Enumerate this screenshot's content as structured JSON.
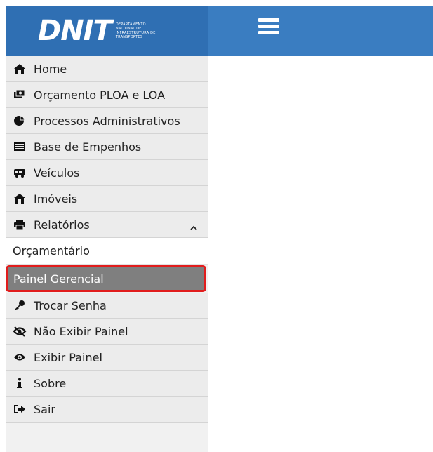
{
  "header": {
    "logo_text": "DNIT",
    "logo_subtitle": "Departamento Nacional de Infraestrutura de Transportes",
    "menu_icon": "hamburger-icon"
  },
  "sidebar": {
    "items": [
      {
        "label": "Home",
        "icon": "home-icon"
      },
      {
        "label": "Orçamento PLOA e LOA",
        "icon": "money-icon"
      },
      {
        "label": "Processos Administrativos",
        "icon": "pie-chart-icon"
      },
      {
        "label": "Base de Empenhos",
        "icon": "table-icon"
      },
      {
        "label": "Veículos",
        "icon": "bus-icon"
      },
      {
        "label": "Imóveis",
        "icon": "building-icon"
      },
      {
        "label": "Relatórios",
        "icon": "printer-icon",
        "expanded": true
      },
      {
        "label": "Trocar Senha",
        "icon": "key-icon"
      },
      {
        "label": "Não Exibir Painel",
        "icon": "eye-slash-icon"
      },
      {
        "label": "Exibir Painel",
        "icon": "eye-icon"
      },
      {
        "label": "Sobre",
        "icon": "info-icon"
      },
      {
        "label": "Sair",
        "icon": "sign-out-icon"
      }
    ],
    "submenu": [
      {
        "label": "Orçamentário",
        "active": false
      },
      {
        "label": "Painel Gerencial",
        "active": true
      }
    ]
  },
  "colors": {
    "header_bg": "#3a7dc1",
    "active_bg": "#7f7f7f",
    "highlight_border": "#e11d1d"
  }
}
